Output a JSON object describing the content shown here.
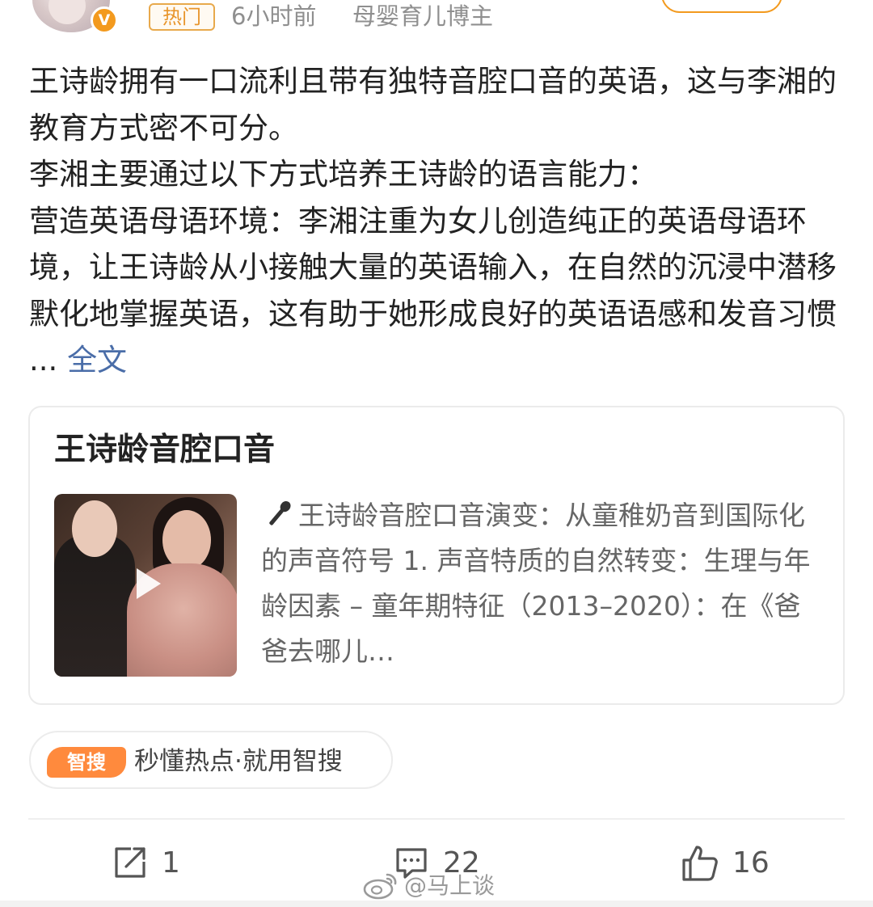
{
  "header": {
    "verified_mark": "V",
    "hot_badge": "热门",
    "time": "6小时前",
    "source": "母婴育儿博主"
  },
  "post": {
    "paragraphs": [
      "王诗龄拥有一口流利且带有独特音腔口音的英语，这与李湘的教育方式密不可分。",
      "李湘主要通过以下方式培养王诗龄的语言能力：",
      "营造英语母语环境：李湘注重为女儿创造纯正的英语母语环境，让王诗龄从小接触大量的英语输入，在自然的沉浸中潜移默化地掌握英语，这有助于她形成良好的英语语感和发音习惯 ..."
    ],
    "full_text_link": "全文"
  },
  "card": {
    "title": "王诗龄音腔口音",
    "description": "王诗龄音腔口音演变：从童稚奶音到国际化的声音符号 1. 声音特质的自然转变：生理与年龄因素 – 童年期特征（2013–2020）：在《爸爸去哪儿…"
  },
  "smart_search": {
    "badge": "智搜",
    "text": "秒懂热点·就用智搜"
  },
  "actions": {
    "repost_count": "1",
    "comment_count": "22",
    "like_count": "16"
  },
  "watermark": {
    "text": "@马上谈"
  },
  "colors": {
    "accent_orange": "#f39a1e",
    "link_blue": "#4a6da8",
    "smart_badge": "#ff8a3d"
  }
}
